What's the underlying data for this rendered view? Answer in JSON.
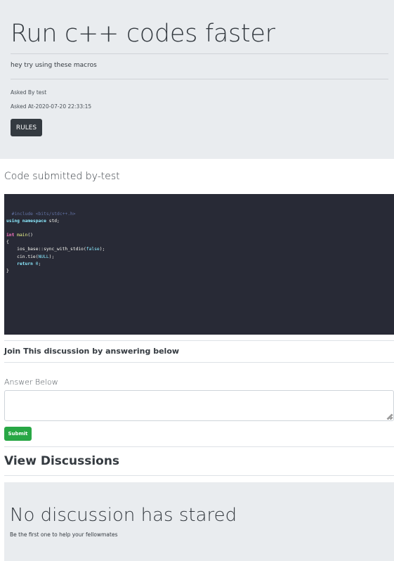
{
  "question": {
    "title": "Run c++ codes faster",
    "description": "hey try using these macros",
    "asked_by": "Asked By test",
    "asked_at": "Asked At-2020-07-20 22:33:15",
    "rules_button": "RULES"
  },
  "code_section": {
    "heading": "Code submitted by-test",
    "lines": [
      "  #include <bits/stdc++.h>",
      "using namespace std;",
      "",
      "int main()",
      "{",
      "    ios_base::sync_with_stdio(false);",
      "    cin.tie(NULL);",
      "    return 0;",
      "}"
    ]
  },
  "join_text": "Join This discussion by answering below",
  "answer": {
    "label": "Answer Below",
    "value": "",
    "submit_label": "Submit"
  },
  "discussions": {
    "title": "View Discussions",
    "empty_heading": "No discussion has stared",
    "empty_subtext": "Be the first one to help your fellowmates"
  },
  "colors": {
    "hero_bg": "#e9ecef",
    "code_bg": "#282a36",
    "dark_button": "#343a40",
    "submit_button": "#28a745"
  }
}
